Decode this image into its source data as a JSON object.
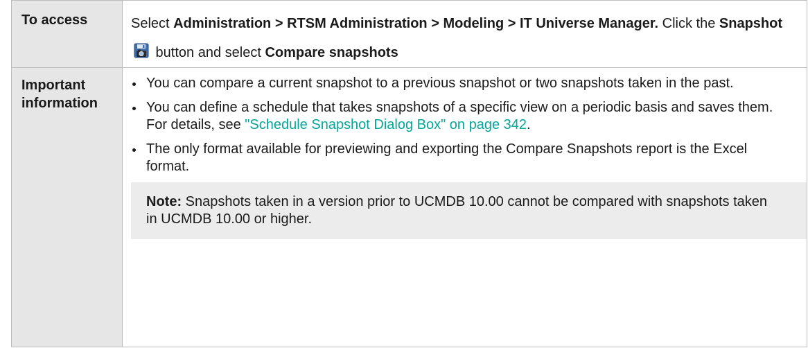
{
  "rows": {
    "access": {
      "label": "To access",
      "t1": "Select ",
      "path": "Administration > RTSM Administration > Modeling > IT Universe Manager.",
      "t2": " Click the ",
      "snapshot": "Snapshot",
      "t3": " button and select ",
      "compare": "Compare snapshots"
    },
    "important": {
      "label": "Important information",
      "bullet1": "You can compare a current snapshot to a previous snapshot or two snapshots taken in the past.",
      "bullet2_text": "You can define a schedule that takes snapshots of a specific view on a periodic basis and saves them. For details, see ",
      "bullet2_link": "\"Schedule Snapshot Dialog Box\" on page 342",
      "bullet2_end": ".",
      "bullet3": "The only format available for previewing and exporting the Compare Snapshots report is the Excel format.",
      "note_label": "Note:",
      "note_text": " Snapshots taken in a version prior to UCMDB 10.00 cannot be compared with snapshots taken in UCMDB 10.00 or higher."
    }
  },
  "icons": {
    "snapshot_button": "snapshot-camera-disk-icon",
    "bullet": "bullet-dot-icon"
  },
  "colors": {
    "label_background": "#e6e6e6",
    "note_background": "#ececec",
    "link": "#06a59a",
    "border": "#bdbdbd"
  }
}
